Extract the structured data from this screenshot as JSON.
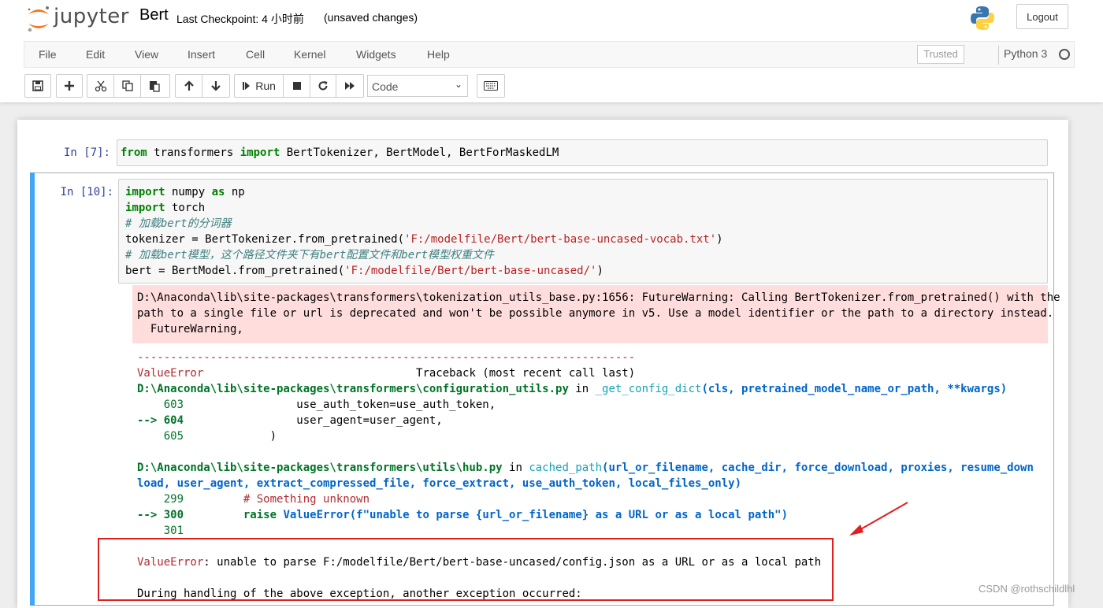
{
  "header": {
    "logo_text": "jupyter",
    "notebook_name": "Bert",
    "checkpoint": "Last Checkpoint: 4 小时前",
    "unsaved": "(unsaved changes)",
    "logout_label": "Logout"
  },
  "menu": {
    "items": [
      "File",
      "Edit",
      "View",
      "Insert",
      "Cell",
      "Kernel",
      "Widgets",
      "Help"
    ],
    "trusted": "Trusted",
    "kernel_name": "Python 3"
  },
  "toolbar": {
    "run_label": "Run",
    "cell_type": "Code"
  },
  "cells": [
    {
      "prompt": "In [7]:",
      "code": [
        [
          {
            "t": "from",
            "c": "kw"
          },
          {
            "t": " transformers "
          },
          {
            "t": "import",
            "c": "kw"
          },
          {
            "t": " BertTokenizer, BertModel, BertForMaskedLM"
          }
        ]
      ]
    },
    {
      "prompt": "In [10]:",
      "code": [
        [
          {
            "t": "import",
            "c": "kw"
          },
          {
            "t": " numpy "
          },
          {
            "t": "as",
            "c": "kw"
          },
          {
            "t": " np"
          }
        ],
        [
          {
            "t": "import",
            "c": "kw"
          },
          {
            "t": " torch"
          }
        ],
        [
          {
            "t": "# 加载bert的分词器",
            "c": "cm"
          }
        ],
        [
          {
            "t": "tokenizer = BertTokenizer.from_pretrained("
          },
          {
            "t": "'F:/modelfile/Bert/bert-base-uncased-vocab.txt'",
            "c": "st"
          },
          {
            "t": ")"
          }
        ],
        [
          {
            "t": "# 加载bert模型，这个路径文件夹下有bert配置文件和bert模型权重文件",
            "c": "cm"
          }
        ],
        [
          {
            "t": "bert = BertModel.from_pretrained("
          },
          {
            "t": "'F:/modelfile/Bert/bert-base-uncased/'",
            "c": "st"
          },
          {
            "t": ")"
          }
        ]
      ],
      "stderr": [
        "D:\\Anaconda\\lib\\site-packages\\transformers\\tokenization_utils_base.py:1656: FutureWarning: Calling BertTokenizer.from_pretrained() with the",
        "path to a single file or url is deprecated and won't be possible anymore in v5. Use a model identifier or the path to a directory instead.",
        "  FutureWarning,"
      ],
      "traceback": [
        [
          {
            "t": "---------------------------------------------------------------------------",
            "c": "red"
          }
        ],
        [
          {
            "t": "ValueError",
            "c": "red"
          },
          {
            "t": "                                Traceback (most recent call last)"
          }
        ],
        [
          {
            "t": "D:\\Anaconda\\lib\\site-packages\\transformers\\configuration_utils.py",
            "c": "grnb"
          },
          {
            "t": " in "
          },
          {
            "t": "_get_config_dict",
            "c": "cyn"
          },
          {
            "t": "(cls, pretrained_model_name_or_path, **kwargs)",
            "c": "blub"
          }
        ],
        [
          {
            "t": "    603",
            "c": "grn"
          },
          {
            "t": "                 use_auth_token=use_auth_token,"
          }
        ],
        [
          {
            "t": "--> 604",
            "c": "grnb"
          },
          {
            "t": "                 user_agent=user_agent,"
          }
        ],
        [
          {
            "t": "    605",
            "c": "grn"
          },
          {
            "t": "             )"
          }
        ],
        [
          {
            "t": ""
          }
        ],
        [
          {
            "t": "D:\\Anaconda\\lib\\site-packages\\transformers\\utils\\hub.py",
            "c": "grnb"
          },
          {
            "t": " in "
          },
          {
            "t": "cached_path",
            "c": "cyn"
          },
          {
            "t": "(url_or_filename, cache_dir, force_download, proxies, resume_down",
            "c": "blub"
          }
        ],
        [
          {
            "t": "load, user_agent, extract_compressed_file, force_extract, use_auth_token, local_files_only)",
            "c": "blub"
          }
        ],
        [
          {
            "t": "    299",
            "c": "grn"
          },
          {
            "t": "         "
          },
          {
            "t": "# Something unknown",
            "c": "red"
          }
        ],
        [
          {
            "t": "--> 300",
            "c": "grnb"
          },
          {
            "t": "         "
          },
          {
            "t": "raise",
            "c": "grnb"
          },
          {
            "t": " ValueError(f\"unable to parse {url_or_filename} as a URL or as a local path\")",
            "c": "blub"
          }
        ],
        [
          {
            "t": "    301",
            "c": "grn"
          }
        ],
        [
          {
            "t": ""
          }
        ],
        [
          {
            "t": "ValueError",
            "c": "red"
          },
          {
            "t": ": unable to parse F:/modelfile/Bert/bert-base-uncased/config.json as a URL or as a local path"
          }
        ],
        [
          {
            "t": ""
          }
        ],
        [
          {
            "t": "During handling of the above exception, another exception occurred:"
          }
        ]
      ]
    }
  ],
  "watermark": "CSDN @rothschildlhl",
  "colors": {
    "keyword": "#008000",
    "comment": "#408080",
    "string": "#ba2121",
    "prompt": "#303f9f",
    "stderr_bg": "#ffdddd",
    "selected_bar": "#42a5f5",
    "annotation": "#e02020"
  }
}
